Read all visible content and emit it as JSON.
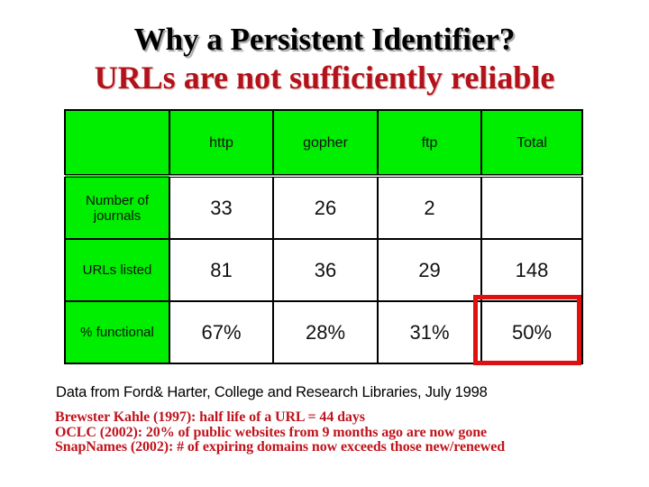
{
  "slide": {
    "title": "Why a Persistent Identifier?",
    "subtitle": "URLs are not sufficiently reliable"
  },
  "table": {
    "columns": [
      "",
      "http",
      "gopher",
      "ftp",
      "Total"
    ],
    "rows": [
      {
        "label": "Number of journals",
        "values": [
          "33",
          "26",
          "2",
          ""
        ]
      },
      {
        "label": "URLs listed",
        "values": [
          "81",
          "36",
          "29",
          "148"
        ]
      },
      {
        "label": "% functional",
        "values": [
          "67%",
          "28%",
          "31%",
          "50%"
        ]
      }
    ],
    "highlighted_cell": {
      "row": "% functional",
      "column": "Total",
      "color": "#e01010"
    },
    "header_color": "#00ee00"
  },
  "source": "Data from Ford& Harter, College and Research Libraries, July 1998",
  "notes": [
    "Brewster Kahle (1997):  half life of a URL = 44 days",
    "OCLC (2002):  20% of public websites from 9 months ago are now gone",
    "SnapNames (2002):  # of expiring domains now exceeds those new/renewed"
  ]
}
